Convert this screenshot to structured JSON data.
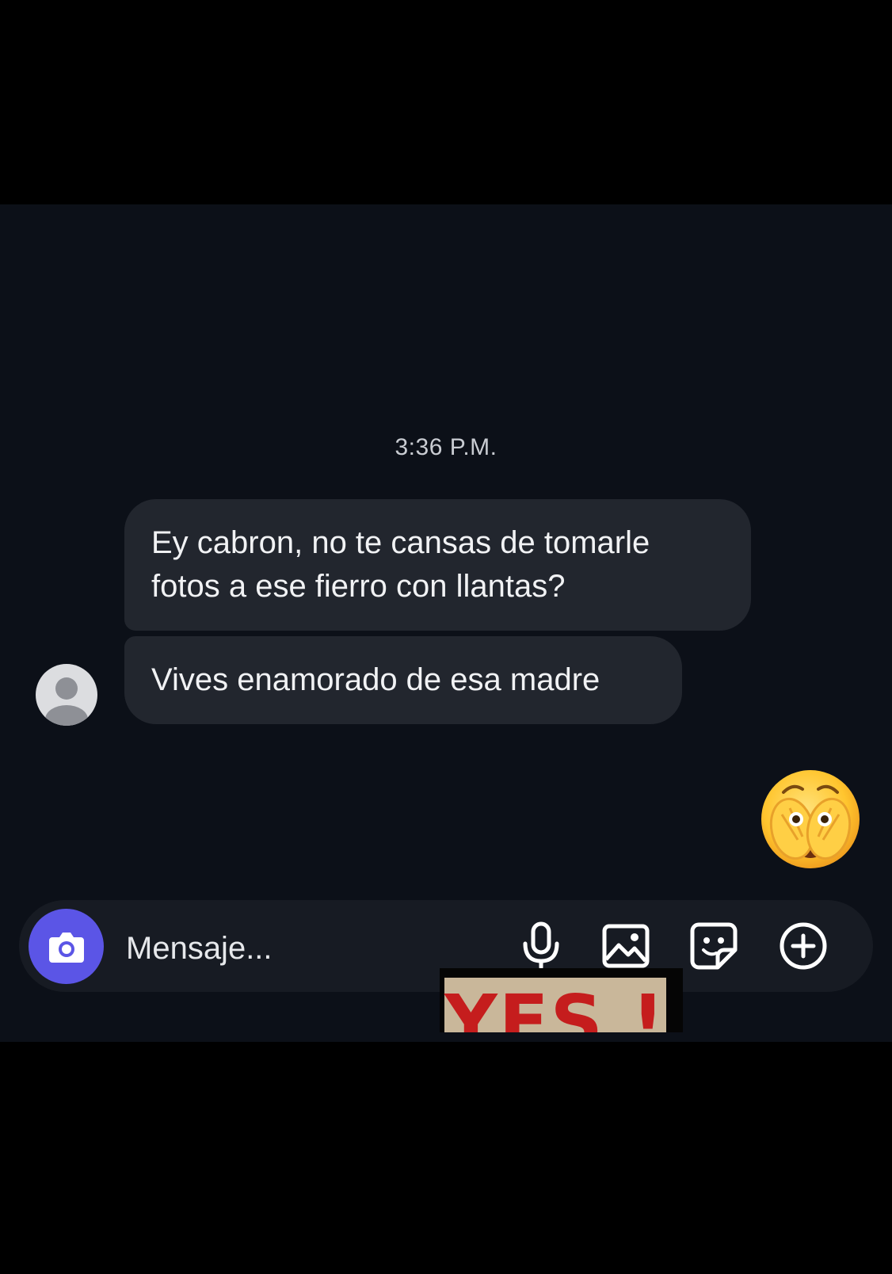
{
  "chat": {
    "timestamp": "3:36 P.M.",
    "messages": [
      {
        "text": "Ey cabron, no te cansas de tomarle fotos a ese fierro con llantas?"
      },
      {
        "text": "Vives enamorado de esa madre"
      }
    ],
    "reaction_icon": "face-with-open-eyes-and-hand-over-mouth-emoji"
  },
  "composer": {
    "placeholder": "Mensaje...",
    "camera_icon": "camera-icon",
    "mic_icon": "microphone-icon",
    "gallery_icon": "image-icon",
    "sticker_icon": "sticker-icon",
    "more_icon": "plus-circle-icon",
    "accent_color": "#5b55e6"
  },
  "overlay": {
    "sticker_text": "YES !"
  },
  "colors": {
    "background": "#0c1018",
    "bubble": "#22262e",
    "text": "#f1f2f4"
  }
}
